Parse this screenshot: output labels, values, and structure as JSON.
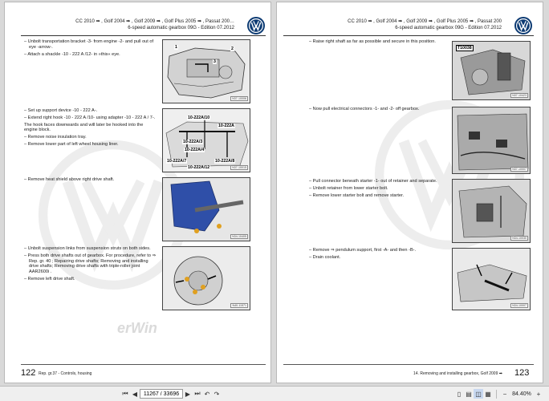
{
  "left_page": {
    "header_line1": "CC 2010 ➡ , Golf 2004 ➡ , Golf 2009 ➡ , Golf Plus 2005 ➡ , Passat 200…",
    "header_line2": "6-speed automatic gearbox 09G - Edition 07.2012",
    "sections": [
      {
        "items": [
          "Unbolt transportation bracket -3- from engine -2- and pull out of eye -arrow-.",
          "Attach a shackle -10 - 222 A /12- in »this« eye."
        ],
        "figure": {
          "code": "N37-10006",
          "labels": [
            "1",
            "2",
            "3"
          ]
        }
      },
      {
        "items": [
          "Set up support device -10 - 222 A-.",
          "Extend right hook -10 - 222 A /10- using adapter -10 - 222 A / 7-."
        ],
        "para": "The hook faces downwards and will later be hooked into the engine block.",
        "items2": [
          "Remove noise insulation tray.",
          "Remove lower part of left wheel housing liner."
        ],
        "figure": {
          "code": "N37-10015",
          "labels": [
            "10-222A/10",
            "10-222A",
            "10-222A/3",
            "10-222A/4",
            "10-222A/7",
            "10-222A/8",
            "10-222A/12"
          ]
        }
      },
      {
        "items": [
          "Remove heat shield above right drive shaft."
        ],
        "figure": {
          "code": "N34-10405"
        }
      },
      {
        "items": [
          "Unbolt suspension links from suspension struts on both sides.",
          "Press both drive shafts out of gearbox. For procedure, refer to ⇒ Rep. gr. 40 ; Repairing drive shafts; Removing and installing drive shafts; Removing drive shafts with triple-roller joint AAR2600i .",
          "Remove left drive shaft."
        ],
        "figure": {
          "code": "N40-11571"
        }
      }
    ],
    "page_number": "122",
    "footer": "Rep. gr.37 - Controls, housing"
  },
  "right_page": {
    "header_line1": "CC 2010 ➡ , Golf 2004 ➡ , Golf 2009 ➡ , Golf Plus 2005 ➡ , Passat 200",
    "header_line2": "6-speed automatic gearbox 09G - Edition 07.2012",
    "sections": [
      {
        "items": [
          "Raise right shaft as far as possible and secure in this position."
        ],
        "figure": {
          "code": "N37-10423",
          "labels": [
            "T10038"
          ]
        }
      },
      {
        "items": [
          "Now pull electrical connectors -1- and -2- off gearbox."
        ],
        "figure": {
          "code": "N37-10007"
        }
      },
      {
        "items": [
          "Pull connector beneath starter -1- out of retainer and separate.",
          "Unbolt retainer from lower starter bolt.",
          "Remove lower starter bolt and remove starter."
        ],
        "figure": {
          "code": "N34-10030"
        }
      },
      {
        "items": [
          "Remove ⇒ pendulum support, first -A- and then -B-.",
          "Drain coolant."
        ],
        "figure": {
          "code": "N34-10007"
        }
      }
    ],
    "page_number": "123",
    "footer": "14. Removing and installing gearbox, Golf 2009 ➡"
  },
  "watermark_text": "erWin",
  "toolbar": {
    "page_field": "11267 / 33696",
    "zoom": "84.40%"
  },
  "colors": {
    "vw_blue": "#0d3b73",
    "page_bg": "#ffffff",
    "viewer_bg": "#d9d9d9"
  }
}
